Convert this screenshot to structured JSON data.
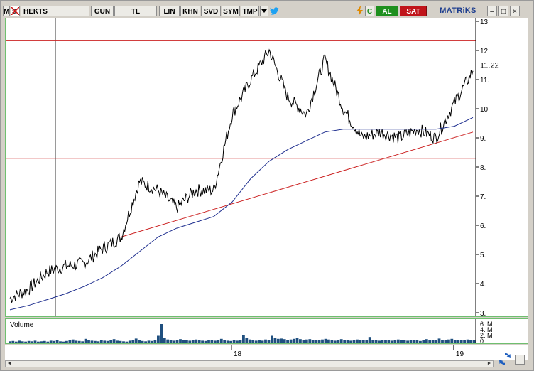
{
  "toolbar": {
    "m_label": "M",
    "symbol": "HEKTS",
    "period": "GUN",
    "currency": "TL",
    "scale": "LIN",
    "khn": "KHN",
    "svd": "SVD",
    "sym": "SYM",
    "tmp": "TMP",
    "c_label": "C",
    "buy": "AL",
    "sell": "SAT",
    "brand": "MATRiKS"
  },
  "icons": {
    "menu": "m-icon",
    "no_symbol": "crossed-symbol-icon",
    "dropdown": "chevron-down-icon",
    "twitter": "twitter-bird-icon",
    "lightning": "lightning-icon",
    "minimize": "minimize-icon",
    "maximize": "maximize-icon",
    "close": "close-icon",
    "refresh": "refresh-icon"
  },
  "colors": {
    "price_line": "#000000",
    "moving_average": "#1f2f8f",
    "trend_line": "#cc2222",
    "horizontal_levels": "#cc2222",
    "volume_bars": "#1f4f7f",
    "panel_border": "#6fbf6f",
    "buy_button": "#1e8f1e",
    "sell_button": "#c0141a"
  },
  "chart_data": {
    "type": "line",
    "y_ticks": [
      "3.",
      "4.",
      "5.",
      "6.",
      "7.",
      "8.",
      "9.",
      "10.",
      "11.",
      "12.",
      "13."
    ],
    "ylim": [
      3,
      13
    ],
    "last_price_label": "11.22",
    "x_ticks": [
      "18",
      "19"
    ],
    "series": [
      {
        "kind": "price",
        "x": [
          "2017-01",
          "2017-02",
          "2017-03",
          "2017-04",
          "2017-05",
          "2017-06",
          "2017-07",
          "2017-08",
          "2017-09",
          "2017-10",
          "2017-11",
          "2017-12",
          "2018-01",
          "2018-02",
          "2018-03",
          "2018-04",
          "2018-05",
          "2018-06",
          "2018-07",
          "2018-08",
          "2018-09",
          "2018-10",
          "2018-11",
          "2018-12",
          "2019-01",
          "2019-02"
        ],
        "values": [
          3.5,
          3.8,
          4.4,
          4.6,
          4.7,
          5.2,
          5.6,
          7.5,
          7.2,
          6.6,
          7.2,
          7.2,
          9.8,
          11.0,
          12.0,
          10.4,
          9.8,
          11.7,
          10.0,
          9.0,
          9.2,
          9.0,
          9.3,
          9.0,
          10.2,
          11.3
        ]
      },
      {
        "kind": "moving_average",
        "x": [
          "2017-01",
          "2017-02",
          "2017-03",
          "2017-04",
          "2017-05",
          "2017-06",
          "2017-07",
          "2017-08",
          "2017-09",
          "2017-10",
          "2017-11",
          "2017-12",
          "2018-01",
          "2018-02",
          "2018-03",
          "2018-04",
          "2018-05",
          "2018-06",
          "2018-07",
          "2018-08",
          "2018-09",
          "2018-10",
          "2018-11",
          "2018-12",
          "2019-01",
          "2019-02"
        ],
        "values": [
          3.1,
          3.25,
          3.45,
          3.65,
          3.9,
          4.2,
          4.6,
          5.1,
          5.6,
          5.9,
          6.1,
          6.3,
          6.8,
          7.6,
          8.2,
          8.6,
          8.9,
          9.2,
          9.3,
          9.3,
          9.3,
          9.3,
          9.3,
          9.3,
          9.4,
          9.7
        ]
      }
    ],
    "horizontal_levels": [
      12.35,
      8.3
    ],
    "trend_line": {
      "x": [
        "2017-07",
        "2019-02"
      ],
      "values": [
        5.6,
        9.2
      ]
    },
    "volume": {
      "label": "Volume",
      "ticks": [
        "6. M",
        "4. M",
        "2. M",
        "0"
      ],
      "values": [
        0.4,
        0.5,
        0.3,
        0.6,
        0.4,
        0.3,
        0.5,
        0.4,
        0.6,
        0.3,
        0.4,
        0.5,
        0.3,
        0.6,
        0.5,
        0.8,
        0.4,
        0.3,
        0.5,
        0.7,
        1.0,
        0.6,
        0.5,
        0.4,
        1.2,
        0.8,
        0.6,
        0.5,
        0.4,
        0.7,
        0.6,
        0.5,
        0.9,
        1.1,
        0.6,
        0.5,
        0.4,
        0.3,
        0.6,
        0.8,
        1.3,
        0.7,
        0.5,
        0.4,
        0.6,
        0.5,
        0.9,
        2.2,
        6.0,
        1.5,
        1.0,
        0.8,
        0.6,
        0.9,
        1.1,
        0.8,
        0.7,
        0.6,
        0.8,
        1.0,
        0.7,
        0.6,
        0.5,
        0.8,
        0.7,
        0.6,
        0.9,
        1.2,
        0.8,
        0.6,
        0.5,
        0.7,
        0.6,
        0.9,
        2.5,
        1.4,
        1.0,
        0.7,
        0.6,
        0.8,
        0.6,
        1.0,
        0.9,
        2.2,
        1.5,
        1.2,
        1.3,
        1.1,
        0.9,
        1.0,
        1.2,
        1.4,
        1.1,
        0.9,
        1.0,
        1.1,
        0.8,
        0.7,
        0.9,
        1.0,
        1.2,
        1.0,
        0.8,
        0.6,
        0.9,
        1.1,
        0.8,
        0.7,
        0.6,
        0.8,
        1.0,
        0.9,
        0.7,
        0.8,
        1.8,
        0.9,
        0.7,
        0.6,
        0.8,
        0.7,
        0.9,
        0.6,
        0.8,
        1.0,
        0.9,
        0.7,
        0.6,
        0.9,
        0.8,
        0.7,
        0.5,
        0.8,
        1.1,
        0.9,
        0.7,
        0.8,
        1.3,
        0.9,
        0.8,
        1.0,
        1.2,
        0.9,
        0.7,
        0.8,
        0.7,
        1.0,
        0.9,
        0.8
      ]
    }
  }
}
